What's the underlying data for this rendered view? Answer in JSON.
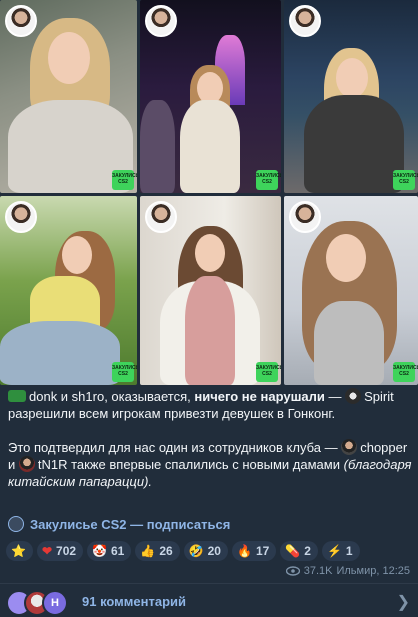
{
  "post": {
    "badge_text": "ЗАКУЛИСЬЕ CS2",
    "line1_part1": "donk и sh1ro, оказывается, ",
    "line1_bold": "ничего не нарушали",
    "line1_part2": " — ",
    "line1_team": "Spirit",
    "line1_part3": " разрешили всем игрокам привезти девушек в Гонконг.",
    "line2_part1": "Это подтвердил для нас один из сотрудников клуба — ",
    "line2_name1": "chopper",
    "line2_part2": " и ",
    "line2_name2": "tN1R",
    "line2_part3": " также впервые спалились с новыми дамами ",
    "line2_italic": "(благодаря китайским папарацци).",
    "channel_link": "Закулисье CS2 — подписаться"
  },
  "reactions": [
    {
      "icon": "star-icon",
      "emoji": "⭐",
      "count": ""
    },
    {
      "icon": "heart-icon",
      "emoji": "❤",
      "count": "702"
    },
    {
      "icon": "clown-icon",
      "emoji": "🤡",
      "count": "61"
    },
    {
      "icon": "thumbs-up-icon",
      "emoji": "👍",
      "count": "26"
    },
    {
      "icon": "laugh-icon",
      "emoji": "🤣",
      "count": "20"
    },
    {
      "icon": "fire-icon",
      "emoji": "🔥",
      "count": "17"
    },
    {
      "icon": "pill-icon",
      "emoji": "💊",
      "count": "2"
    },
    {
      "icon": "lightning-icon",
      "emoji": "⚡",
      "count": "1"
    }
  ],
  "meta": {
    "views": "37.1K",
    "author_time": "Ильмир, 12:25"
  },
  "comments": {
    "label": "91 комментарий",
    "avatar_letter": "Н"
  },
  "colors": {
    "background": "#212d3b",
    "link": "#8fb5e6",
    "badge": "#3ed35b"
  }
}
